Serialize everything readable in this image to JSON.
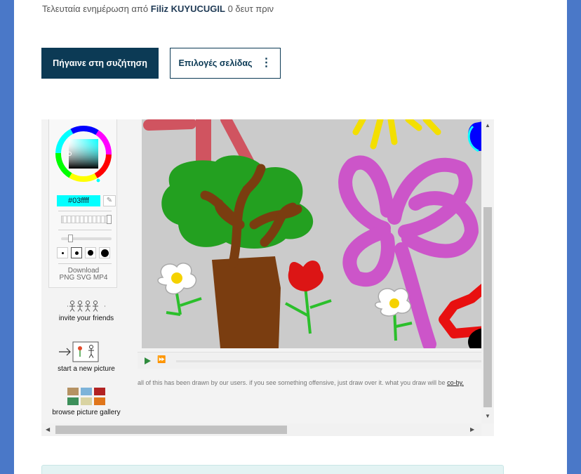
{
  "header": {
    "updated_prefix": "Τελευταία ενημέρωση από",
    "updated_user": "Filiz KUYUCUGIL",
    "updated_suffix": "0 δευτ πριν"
  },
  "actions": {
    "discussion_label": "Πήγαινε στη συζήτηση",
    "page_options_label": "Επιλογές σελίδας",
    "page_options_icon": "vertical-dots-icon"
  },
  "drawing_app": {
    "color_hex": "#03ffff",
    "download_label": "Download",
    "download_formats": "PNG SVG MP4",
    "invite_label": "invite your friends",
    "new_picture_label": "start a new picture",
    "gallery_label": "browse picture gallery",
    "notice_text": "all of this has been drawn by our users. if you see something offensive, just draw over it. what you draw will be",
    "notice_link": "co-by."
  },
  "colors": {
    "primary": "#0c3a55",
    "frame": "#4a78c8",
    "selected_color": "#03ffff"
  }
}
